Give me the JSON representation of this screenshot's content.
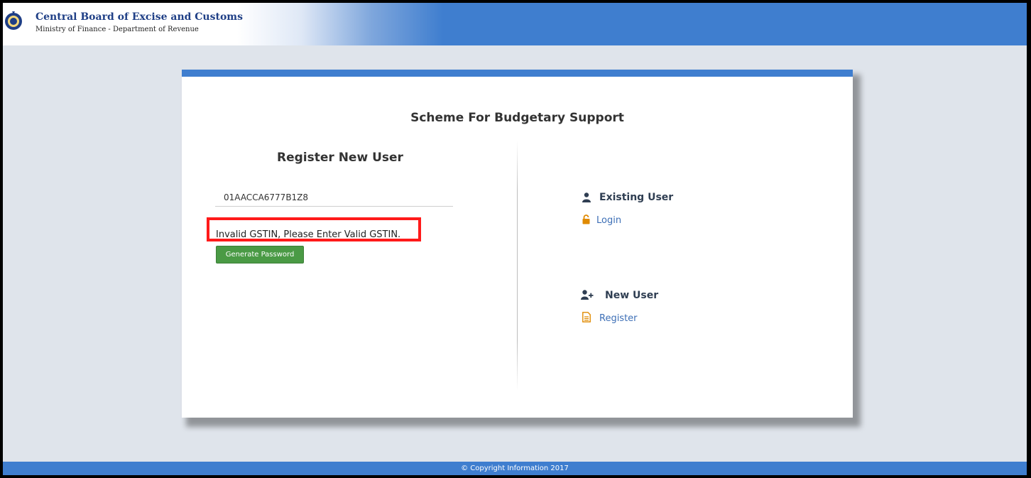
{
  "header": {
    "org_name": "Central Board of Excise and Customs",
    "org_subtitle": "Ministry of Finance - Department of Revenue",
    "emblem_icon": "emblem-icon",
    "accent_color": "#3f7ecf"
  },
  "card": {
    "title": "Scheme For Budgetary Support"
  },
  "register": {
    "title": "Register New User",
    "gstin_value": "01AACCA6777B1Z8",
    "error_message": "Invalid GSTIN, Please Enter Valid GSTIN.",
    "error_highlight_color": "#ff1a1a",
    "generate_button": "Generate Password",
    "button_color": "#4a9a45"
  },
  "existing_user": {
    "title": "Existing User",
    "title_icon": "user-icon",
    "link_label": "Login",
    "link_icon": "unlock-icon"
  },
  "new_user": {
    "title": "New User",
    "title_icon": "user-plus-icon",
    "link_label": "Register",
    "link_icon": "document-icon"
  },
  "footer": {
    "text": "© Copyright Information 2017"
  }
}
